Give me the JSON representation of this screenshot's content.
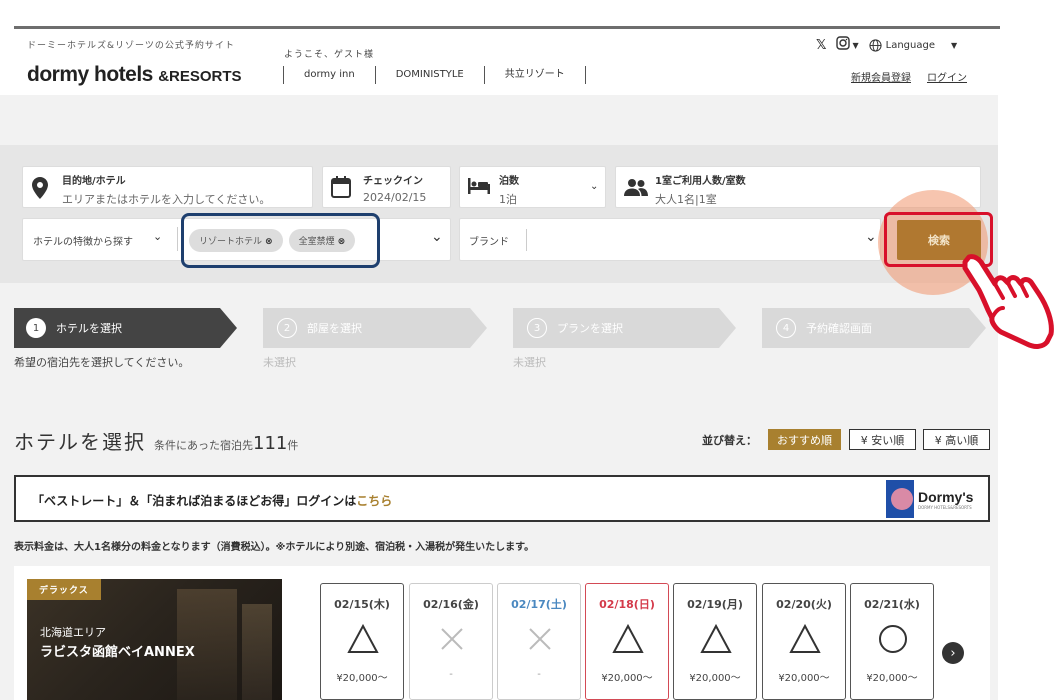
{
  "header": {
    "tagline": "ドーミーホテルズ&リゾーツの公式予約サイト",
    "welcome": "ようこそ、ゲスト様",
    "logo_main": "dormy hotels",
    "logo_sub": "&RESORTS",
    "brands": [
      "dormy inn",
      "DOMINISTYLE",
      "共立リゾート"
    ],
    "language_label": "Language",
    "register_link": "新規会員登録",
    "login_link": "ログイン"
  },
  "search": {
    "destination_label": "目的地/ホテル",
    "destination_placeholder": "エリアまたはホテルを入力してください。",
    "checkin_label": "チェックイン",
    "checkin_value": "2024/02/15",
    "nights_label": "泊数",
    "nights_value": "1泊",
    "guests_label": "1室ご利用人数/室数",
    "guests_value": "大人1名|1室",
    "feature_label": "ホテルの特徴から探す",
    "feature_chips": [
      "リゾートホテル",
      "全室禁煙"
    ],
    "brand_label": "ブランド",
    "search_button": "検索"
  },
  "steps": [
    {
      "num": "1",
      "label": "ホテルを選択",
      "sub": "希望の宿泊先を選択してください。"
    },
    {
      "num": "2",
      "label": "部屋を選択",
      "sub": "未選択"
    },
    {
      "num": "3",
      "label": "プランを選択",
      "sub": "未選択"
    },
    {
      "num": "4",
      "label": "予約確認画面",
      "sub": ""
    }
  ],
  "results": {
    "title": "ホテルを選択",
    "count_prefix": "条件にあった宿泊先",
    "count": "111",
    "count_suffix": "件",
    "sort_label": "並び替え：",
    "sort_options": [
      "おすすめ順",
      "¥ 安い順",
      "¥ 高い順"
    ]
  },
  "banner": {
    "text_before": "「ベストレート」＆「泊まれば泊まるほどお得」ログインは",
    "text_link": "こちら",
    "logo_text": "Dormy's",
    "logo_subtext": "DORMY HOTELS&RESORTS"
  },
  "price_note": "表示料金は、大人1名様分の料金となります（消費税込）。※ホテルにより別途、宿泊税・入湯税が発生いたします。",
  "hotel": {
    "badge": "デラックス",
    "area": "北海道エリア",
    "name": "ラビスタ函館ベイANNEX"
  },
  "dates": [
    {
      "date": "02/15(木)",
      "mark": "triangle",
      "price": "¥20,000〜",
      "type": "weekday"
    },
    {
      "date": "02/16(金)",
      "mark": "cross",
      "price": "-",
      "type": "fri"
    },
    {
      "date": "02/17(土)",
      "mark": "cross",
      "price": "-",
      "type": "sat"
    },
    {
      "date": "02/18(日)",
      "mark": "triangle",
      "price": "¥20,000〜",
      "type": "sun"
    },
    {
      "date": "02/19(月)",
      "mark": "triangle",
      "price": "¥20,000〜",
      "type": "weekday"
    },
    {
      "date": "02/20(火)",
      "mark": "triangle",
      "price": "¥20,000〜",
      "type": "weekday"
    },
    {
      "date": "02/21(水)",
      "mark": "circle",
      "price": "¥20,000〜",
      "type": "weekday"
    }
  ],
  "colors": {
    "accent": "#a8802f",
    "step_active": "#444444",
    "step_inactive": "#d9d9d9",
    "highlight_red": "#d8102a",
    "highlight_blue": "#1e3f6e"
  }
}
